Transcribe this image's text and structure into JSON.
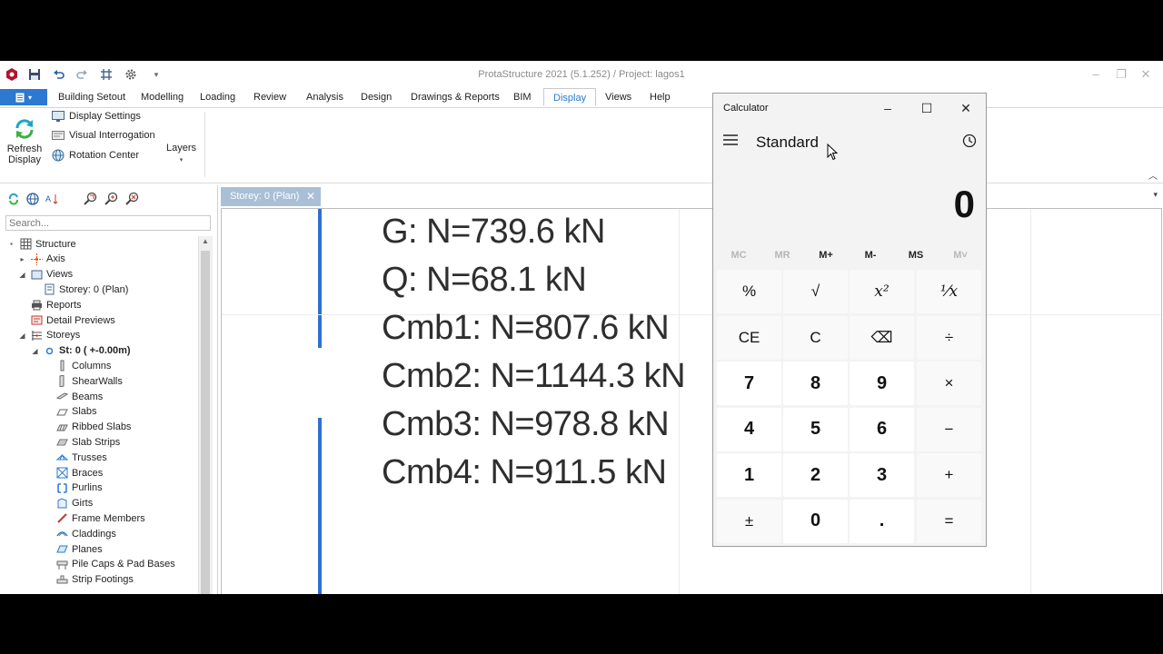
{
  "app": {
    "title": "ProtaStructure 2021 (5.1.252) / Project: lagos1"
  },
  "menu": {
    "items": [
      "Building Setout",
      "Modelling",
      "Loading",
      "Review",
      "Analysis",
      "Design",
      "Drawings & Reports",
      "BIM",
      "Display",
      "Views",
      "Help"
    ],
    "active": "Display"
  },
  "ribbon": {
    "refresh_line1": "Refresh",
    "refresh_line2": "Display",
    "display_settings": "Display Settings",
    "visual_interrogation": "Visual Interrogation",
    "rotation_center": "Rotation Center",
    "layers": "Layers"
  },
  "panel": {
    "search_placeholder": "Search...",
    "tree": [
      {
        "label": "Structure",
        "level": 0,
        "toggle": "▪",
        "icon": "structure-icon",
        "bold": false
      },
      {
        "label": "Axis",
        "level": 1,
        "toggle": "▸",
        "icon": "axis-icon",
        "bold": false
      },
      {
        "label": "Views",
        "level": 1,
        "toggle": "◢",
        "icon": "views-icon",
        "bold": false
      },
      {
        "label": "Storey: 0 (Plan)",
        "level": 2,
        "toggle": "",
        "icon": "plan-icon",
        "bold": false
      },
      {
        "label": "Reports",
        "level": 1,
        "toggle": "",
        "icon": "printer-icon",
        "bold": false
      },
      {
        "label": "Detail Previews",
        "level": 1,
        "toggle": "",
        "icon": "detail-preview-icon",
        "bold": false
      },
      {
        "label": "Storeys",
        "level": 1,
        "toggle": "◢",
        "icon": "storeys-icon",
        "bold": false
      },
      {
        "label": "St: 0 ( +-0.00m)",
        "level": 2,
        "toggle": "◢",
        "icon": "storey-circle-icon",
        "bold": true
      },
      {
        "label": "Columns",
        "level": 3,
        "toggle": "",
        "icon": "columns-icon",
        "bold": false
      },
      {
        "label": "ShearWalls",
        "level": 3,
        "toggle": "",
        "icon": "shearwalls-icon",
        "bold": false
      },
      {
        "label": "Beams",
        "level": 3,
        "toggle": "",
        "icon": "beams-icon",
        "bold": false
      },
      {
        "label": "Slabs",
        "level": 3,
        "toggle": "",
        "icon": "slabs-icon",
        "bold": false
      },
      {
        "label": "Ribbed Slabs",
        "level": 3,
        "toggle": "",
        "icon": "ribbed-slabs-icon",
        "bold": false
      },
      {
        "label": "Slab Strips",
        "level": 3,
        "toggle": "",
        "icon": "slab-strips-icon",
        "bold": false
      },
      {
        "label": "Trusses",
        "level": 3,
        "toggle": "",
        "icon": "trusses-icon",
        "bold": false
      },
      {
        "label": "Braces",
        "level": 3,
        "toggle": "",
        "icon": "braces-icon",
        "bold": false
      },
      {
        "label": "Purlins",
        "level": 3,
        "toggle": "",
        "icon": "purlins-icon",
        "bold": false
      },
      {
        "label": "Girts",
        "level": 3,
        "toggle": "",
        "icon": "girts-icon",
        "bold": false
      },
      {
        "label": "Frame Members",
        "level": 3,
        "toggle": "",
        "icon": "frame-members-icon",
        "bold": false
      },
      {
        "label": "Claddings",
        "level": 3,
        "toggle": "",
        "icon": "claddings-icon",
        "bold": false
      },
      {
        "label": "Planes",
        "level": 3,
        "toggle": "",
        "icon": "planes-icon",
        "bold": false
      },
      {
        "label": "Pile Caps & Pad Bases",
        "level": 3,
        "toggle": "",
        "icon": "pile-caps-icon",
        "bold": false
      },
      {
        "label": "Strip Footings",
        "level": 3,
        "toggle": "",
        "icon": "strip-footings-icon",
        "bold": false
      }
    ]
  },
  "document": {
    "tab_label": "Storey: 0 (Plan)",
    "results": [
      "G: N=739.6 kN",
      "Q: N=68.1 kN",
      "Cmb1: N=807.6 kN",
      "Cmb2: N=1144.3 kN",
      "Cmb3: N=978.8 kN",
      "Cmb4: N=911.5 kN"
    ]
  },
  "calculator": {
    "title": "Calculator",
    "mode": "Standard",
    "display": "0",
    "memory": [
      {
        "label": "MC",
        "enabled": false
      },
      {
        "label": "MR",
        "enabled": false
      },
      {
        "label": "M+",
        "enabled": true
      },
      {
        "label": "M-",
        "enabled": true
      },
      {
        "label": "MS",
        "enabled": true
      },
      {
        "label": "M˅",
        "enabled": false
      }
    ],
    "keys": [
      {
        "label": "%",
        "type": "op",
        "name": "percent-key"
      },
      {
        "label": "√",
        "type": "op",
        "name": "sqrt-key"
      },
      {
        "label": "x²",
        "type": "op",
        "name": "square-key"
      },
      {
        "label": "¹⁄x",
        "type": "op",
        "name": "reciprocal-key"
      },
      {
        "label": "CE",
        "type": "op",
        "name": "clear-entry-key"
      },
      {
        "label": "C",
        "type": "op",
        "name": "clear-key"
      },
      {
        "label": "⌫",
        "type": "op",
        "name": "backspace-key"
      },
      {
        "label": "÷",
        "type": "op",
        "name": "divide-key"
      },
      {
        "label": "7",
        "type": "num",
        "name": "digit-7-key"
      },
      {
        "label": "8",
        "type": "num",
        "name": "digit-8-key"
      },
      {
        "label": "9",
        "type": "num",
        "name": "digit-9-key"
      },
      {
        "label": "×",
        "type": "op",
        "name": "multiply-key"
      },
      {
        "label": "4",
        "type": "num",
        "name": "digit-4-key"
      },
      {
        "label": "5",
        "type": "num",
        "name": "digit-5-key"
      },
      {
        "label": "6",
        "type": "num",
        "name": "digit-6-key"
      },
      {
        "label": "−",
        "type": "op",
        "name": "minus-key"
      },
      {
        "label": "1",
        "type": "num",
        "name": "digit-1-key"
      },
      {
        "label": "2",
        "type": "num",
        "name": "digit-2-key"
      },
      {
        "label": "3",
        "type": "num",
        "name": "digit-3-key"
      },
      {
        "label": "+",
        "type": "op",
        "name": "plus-key"
      },
      {
        "label": "±",
        "type": "op",
        "name": "negate-key"
      },
      {
        "label": "0",
        "type": "num",
        "name": "digit-0-key"
      },
      {
        "label": ".",
        "type": "num",
        "name": "decimal-key"
      },
      {
        "label": "=",
        "type": "eq",
        "name": "equals-key"
      }
    ]
  }
}
